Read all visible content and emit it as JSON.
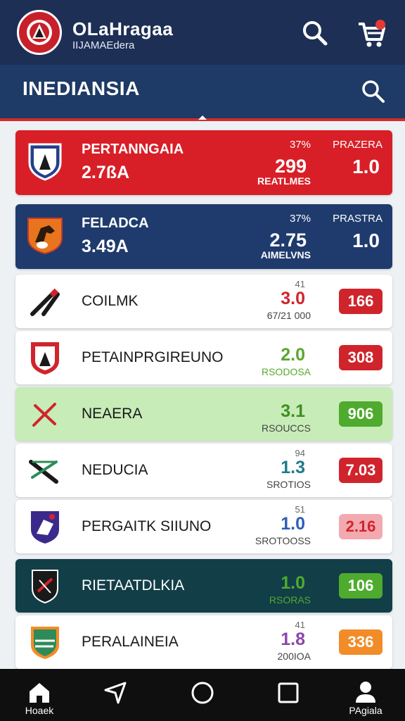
{
  "app": {
    "title": "OLaHragaa",
    "subtitle": "IIJAMAEdera"
  },
  "header": {
    "section_title": "INEDIANSIA"
  },
  "featured": [
    {
      "name": "PERTANNGAIA",
      "sub": "2.7ßA",
      "pct": "37%",
      "value": "299",
      "caption": "REATLMES",
      "right_label": "PRAZERA",
      "right_value": "1.0"
    },
    {
      "name": "FELADCA",
      "sub": "3.49A",
      "pct": "37%",
      "value": "2.75",
      "caption": "AIMELVNS",
      "right_label": "PRASTRA",
      "right_value": "1.0"
    }
  ],
  "items": [
    {
      "name": "COILMK",
      "top": "41",
      "value": "3.0",
      "caption": "67/21 000",
      "pill": "166",
      "value_color": "#d0242c",
      "pill_color": "#d0242c"
    },
    {
      "name": "PETAINPRGIREUNO",
      "top": "",
      "value": "2.0",
      "caption": "RSODOSA",
      "pill": "308",
      "value_color": "#5aa82f",
      "pill_color": "#d0242c"
    },
    {
      "name": "NEAERA",
      "top": "",
      "value": "3.1",
      "caption": "RSOUCCS",
      "pill": "906",
      "value_color": "#3e8f1f",
      "pill_color": "#4eab2d"
    },
    {
      "name": "NEDUCIA",
      "top": "94",
      "value": "1.3",
      "caption": "SROTIOS",
      "pill": "7.03",
      "value_color": "#1f7a8c",
      "pill_color": "#d0242c"
    },
    {
      "name": "PERGAITK SIIUNO",
      "top": "51",
      "value": "1.0",
      "caption": "SROTOOSS",
      "pill": "2.16",
      "value_color": "#2b5fb8",
      "pill_color": "#f3a9b0"
    },
    {
      "name": "RIETAATDLKIA",
      "top": "",
      "value": "1.0",
      "caption": "RSORAS",
      "pill": "106",
      "value_color": "#4eab2d",
      "pill_color": "#4eab2d"
    },
    {
      "name": "PERALAINEIA",
      "top": "41",
      "value": "1.8",
      "caption": "200IOA",
      "pill": "336",
      "value_color": "#8e44ad",
      "pill_color": "#f28c28"
    }
  ],
  "nav": [
    {
      "label": "Hoaek",
      "icon": "home-icon"
    },
    {
      "label": "",
      "icon": "back-icon"
    },
    {
      "label": "",
      "icon": "home-circle-icon"
    },
    {
      "label": "",
      "icon": "recents-icon"
    },
    {
      "label": "PAgiala",
      "icon": "profile-icon"
    }
  ],
  "colors": {
    "topbar": "#1d2f55",
    "subbar": "#1e3a66",
    "accent_red": "#d81f27",
    "navbar": "#0f0f10"
  }
}
